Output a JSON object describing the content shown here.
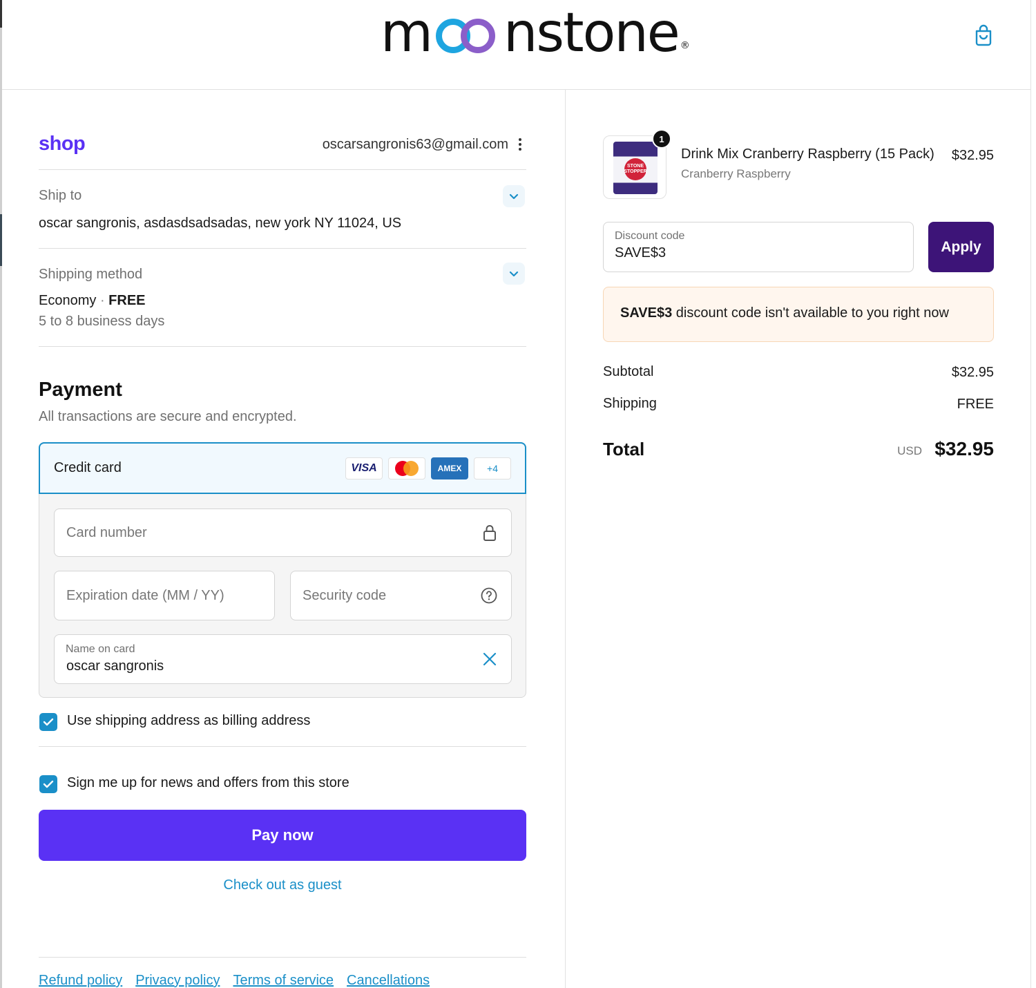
{
  "brand": {
    "name_pre": "m",
    "name_post": "nstone",
    "registered": "®"
  },
  "header": {
    "cart_icon": "shopping-bag-icon"
  },
  "account": {
    "shop_label": "shop",
    "email": "oscarsangronis63@gmail.com"
  },
  "ship_to": {
    "label": "Ship to",
    "value": "oscar sangronis, asdasdsadsadas, new york NY 11024, US"
  },
  "shipping_method": {
    "label": "Shipping method",
    "name": "Economy",
    "separator": "·",
    "price": "FREE",
    "eta": "5 to 8 business days"
  },
  "payment": {
    "title": "Payment",
    "subtitle": "All transactions are secure and encrypted.",
    "method_label": "Credit card",
    "card_logos": {
      "visa": "VISA",
      "amex": "AMEX",
      "more": "+4"
    },
    "card_number_placeholder": "Card number",
    "expiration_placeholder": "Expiration date (MM / YY)",
    "security_placeholder": "Security code",
    "name_label": "Name on card",
    "name_value": "oscar sangronis"
  },
  "options": {
    "billing_same": "Use shipping address as billing address",
    "newsletter": "Sign me up for news and offers from this store"
  },
  "actions": {
    "pay_now": "Pay now",
    "guest": "Check out as guest"
  },
  "footer": {
    "links": [
      "Refund policy",
      "Privacy policy",
      "Terms of service",
      "Cancellations"
    ]
  },
  "order": {
    "quantity": "1",
    "product_name": "Drink Mix Cranberry Raspberry (15 Pack)",
    "variant": "Cranberry Raspberry",
    "price": "$32.95",
    "package_text": "STONE STOPPER"
  },
  "discount": {
    "label": "Discount code",
    "value": "SAVE$3",
    "apply": "Apply",
    "error_code": "SAVE$3",
    "error_text": " discount code isn't available to you right now"
  },
  "summary": {
    "subtotal_label": "Subtotal",
    "subtotal": "$32.95",
    "shipping_label": "Shipping",
    "shipping": "FREE",
    "total_label": "Total",
    "currency": "USD",
    "total": "$32.95"
  },
  "colors": {
    "primary": "#5a31f4",
    "accent": "#1a8fc8",
    "apply": "#3d1478",
    "logo_blue": "#1ea5e0",
    "logo_purple": "#8b5ec9"
  }
}
